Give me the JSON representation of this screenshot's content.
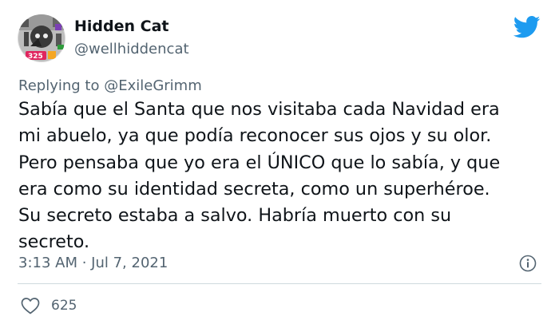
{
  "author": {
    "display_name": "Hidden Cat",
    "handle": "@wellhiddencat",
    "avatar_badge": "325"
  },
  "reply": {
    "prefix": "Replying to",
    "handle": "@ExileGrimm"
  },
  "tweet": {
    "lines": [
      "Sabía que el Santa que nos visitaba cada Navidad era",
      "mi abuelo, ya que podía reconocer sus ojos y su olor.",
      "Pero pensaba que yo era el ÚNICO que lo sabía, y que",
      "era como su identidad secreta, como un superhéroe.",
      "Su secreto estaba a salvo. Habría muerto con su",
      "secreto."
    ],
    "timestamp": "3:13 AM · Jul 7, 2021"
  },
  "engagement": {
    "likes": "625"
  },
  "colors": {
    "twitter_blue": "#1d9bf0",
    "secondary_text": "#536471",
    "primary_text": "#0f1419",
    "divider": "#cfd9de"
  },
  "icons": {
    "logo": "twitter-bird-icon",
    "info": "info-icon",
    "like": "heart-icon"
  }
}
